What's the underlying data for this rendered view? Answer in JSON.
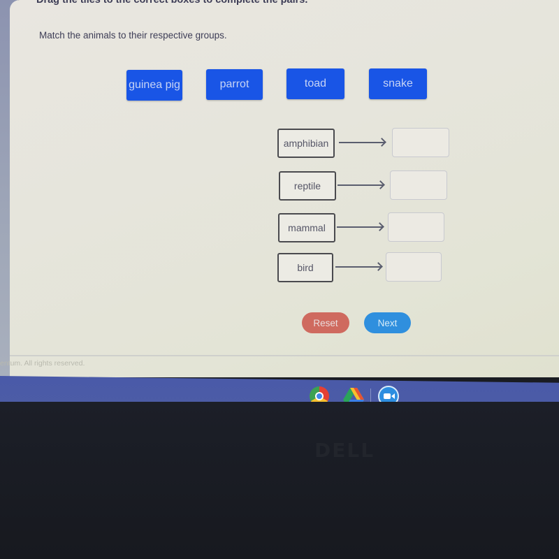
{
  "question": {
    "instruction": "Drag the tiles to the correct boxes to complete the pairs.",
    "prompt": "Match the animals to their respective groups."
  },
  "tiles": [
    {
      "label": "guinea pig"
    },
    {
      "label": "parrot"
    },
    {
      "label": "toad"
    },
    {
      "label": "snake"
    }
  ],
  "pairs": [
    {
      "label": "amphibian",
      "answer": ""
    },
    {
      "label": "reptile",
      "answer": ""
    },
    {
      "label": "mammal",
      "answer": ""
    },
    {
      "label": "bird",
      "answer": ""
    }
  ],
  "buttons": {
    "reset": "Reset",
    "next": "Next"
  },
  "footer": {
    "copyright": "entum. All rights reserved."
  },
  "shelf": {
    "apps": [
      "chrome-icon",
      "google-drive-icon",
      "zoom-icon"
    ]
  },
  "bezel": {
    "brand": "DELL"
  },
  "colors": {
    "tile": "#1955e6",
    "reset": "#cf6a5f",
    "next": "#2f8fde",
    "taskbar": "#4a5aa8"
  }
}
